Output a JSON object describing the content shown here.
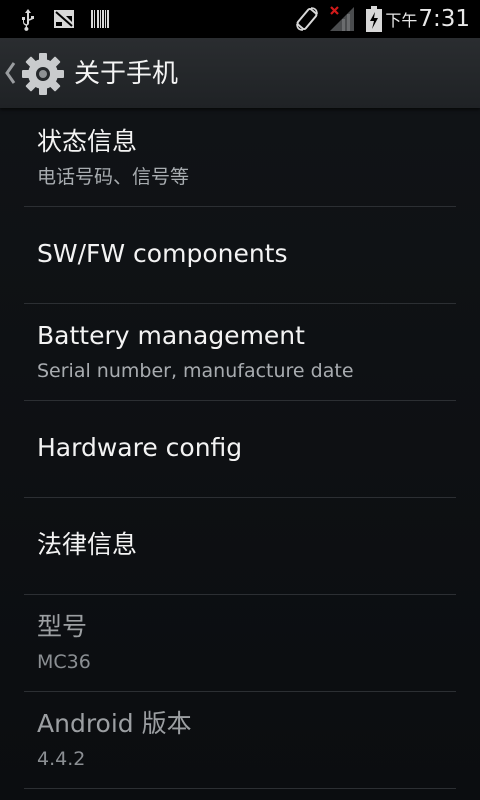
{
  "status_bar": {
    "time_prefix": "下午",
    "time": "7:31",
    "icons": [
      "usb-icon",
      "debug-icon",
      "barcode-icon",
      "rotate-icon",
      "signal-icon",
      "battery-icon"
    ]
  },
  "action_bar": {
    "title": "关于手机",
    "icon": "settings-gear-icon"
  },
  "list": {
    "items": [
      {
        "title": "状态信息",
        "subtitle": "电话号码、信号等"
      },
      {
        "title": "SW/FW components"
      },
      {
        "title": "Battery management",
        "subtitle": "Serial number, manufacture date"
      },
      {
        "title": "Hardware config"
      },
      {
        "title": "法律信息"
      },
      {
        "title": "型号",
        "subtitle": "MC36"
      },
      {
        "title": "Android 版本",
        "subtitle": "4.4.2"
      }
    ]
  },
  "colors": {
    "background": "#0b0d10",
    "action_bar": "#25282b",
    "status_bar": "#000000",
    "primary_text": "#f3f3f3",
    "secondary_text": "#a8acb0",
    "divider": "#2c2f33",
    "signal_x": "#d11a1a"
  }
}
